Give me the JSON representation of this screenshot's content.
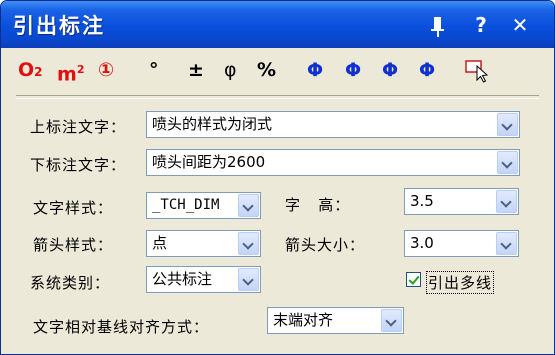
{
  "window": {
    "title": "引出标注"
  },
  "titlebar": {
    "help_label": "?",
    "close_label": "✕"
  },
  "toolbar": {
    "items": [
      {
        "label": "O",
        "sub": "2",
        "color": "#e01010"
      },
      {
        "label": "m",
        "sup": "2",
        "color": "#e01010"
      },
      {
        "label": "①",
        "color": "#e01010"
      },
      {
        "label": "°",
        "color": "#000000"
      },
      {
        "label": "±",
        "color": "#000000"
      },
      {
        "label": "φ",
        "color": "#000000"
      },
      {
        "label": "%",
        "color": "#000000"
      },
      {
        "label": "Φ",
        "color": "#1030d0"
      },
      {
        "label": "Φ",
        "color": "#1030d0"
      },
      {
        "label": "Φ",
        "color": "#1030d0"
      },
      {
        "label": "Φ",
        "color": "#1030d0"
      }
    ]
  },
  "form": {
    "upper_text": {
      "label": "上标注文字：",
      "value": "喷头的样式为闭式"
    },
    "lower_text": {
      "label": "下标注文字：",
      "value": "喷头间距为2600"
    },
    "text_style": {
      "label": "文字样式：",
      "value": "_TCH_DIM"
    },
    "char_height": {
      "label": "字   高：",
      "value": "3.5"
    },
    "arrow_style": {
      "label": "箭头样式：",
      "value": "点"
    },
    "arrow_size": {
      "label": "箭头大小：",
      "value": "3.0"
    },
    "system_type": {
      "label": "系统类别：",
      "value": "公共标注"
    },
    "multi_leader": {
      "label": "引出多线",
      "checked": true
    },
    "align_mode": {
      "label": "文字相对基线对齐方式：",
      "value": "末端对齐"
    }
  }
}
